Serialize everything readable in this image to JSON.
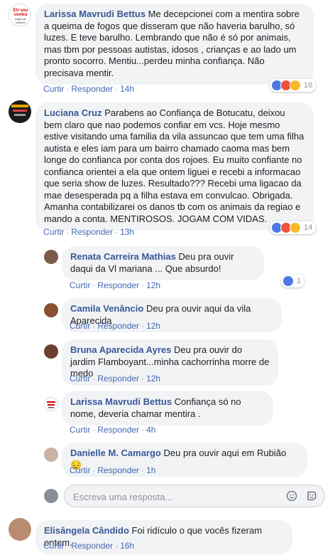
{
  "comments": [
    {
      "author": "Larissa Mavrudi Bettus",
      "text": "Me decepcionei com a mentira sobre a queima de fogos que disseram que não haveria barulho, só luzes. E teve barulho. Lembrando que não é só por animais, mas tbm por pessoas autistas, idosos , crianças e ao lado um pronto socorro. Mentiu...perdeu minha confiança. Não precisava mentir.",
      "like_label": "Curtir",
      "reply_label": "Responder",
      "time": "14h",
      "reactions": [
        "like",
        "angry",
        "haha"
      ],
      "reaction_count": "16",
      "avatar_text": [
        "EU sou",
        "contra",
        "fogos de",
        "barulho"
      ]
    },
    {
      "author": "Luciana Cruz",
      "text": "Parabens ao Confiança de Botucatu, deixou bem claro que nao podemos confiar em vcs. Hoje mesmo estive visitando uma familia da vila assuncao que tem uma filha autista e eles iam para um bairro chamado caoma mas bem longe do confianca por conta dos rojoes. Eu muito confiante no confianca orientei a ela que ontem liguei e recebi a informacao que seria show de luzes. Resultado??? Recebi uma ligacao da mae desesperada pq a filha estava em convulcao. Obrigada. Amanha contabilizarei os danos tb com os animais da regiao e mando a conta. MENTIROSOS. JOGAM COM VIDAS.",
      "like_label": "Curtir",
      "reply_label": "Responder",
      "time": "13h",
      "reactions": [
        "like",
        "angry",
        "haha"
      ],
      "reaction_count": "14"
    }
  ],
  "replies": [
    {
      "author": "Renata Carreira Mathias",
      "text": "Deu pra ouvir daqui da Vl mariana ... Que absurdo!",
      "like_label": "Curtir",
      "reply_label": "Responder",
      "time": "12h",
      "reactions": [
        "like"
      ],
      "reaction_count": "1"
    },
    {
      "author": "Camila Venâncio",
      "text": "Deu pra ouvir aqui da vila Aparecida",
      "like_label": "Curtir",
      "reply_label": "Responder",
      "time": "12h"
    },
    {
      "author": "Bruna Aparecida Ayres",
      "text": "Deu pra ouvir do jardim Flamboyant...minha cachorrinha morre de medo",
      "like_label": "Curtir",
      "reply_label": "Responder",
      "time": "12h"
    },
    {
      "author": "Larissa Mavrudi Bettus",
      "text": "Confiança só no nome, deveria chamar mentira .",
      "like_label": "Curtir",
      "reply_label": "Responder",
      "time": "4h"
    },
    {
      "author": "Danielle M. Camargo",
      "text": "Deu pra ouvir aqui em Rubião",
      "emoji": "😔",
      "like_label": "Curtir",
      "reply_label": "Responder",
      "time": "1h"
    }
  ],
  "reply_input": {
    "placeholder": "Escreva uma resposta..."
  },
  "last_comment": {
    "author": "Elisângela Cândido",
    "text": "Foi ridículo o que vocês fizeram ontem.",
    "like_label": "Curtir",
    "reply_label": "Responder",
    "time": "16h"
  },
  "separator": "·",
  "colors": {
    "link": "#385898",
    "action": "#4267b2",
    "bubble": "#f2f3f5",
    "meta": "#90949c"
  }
}
